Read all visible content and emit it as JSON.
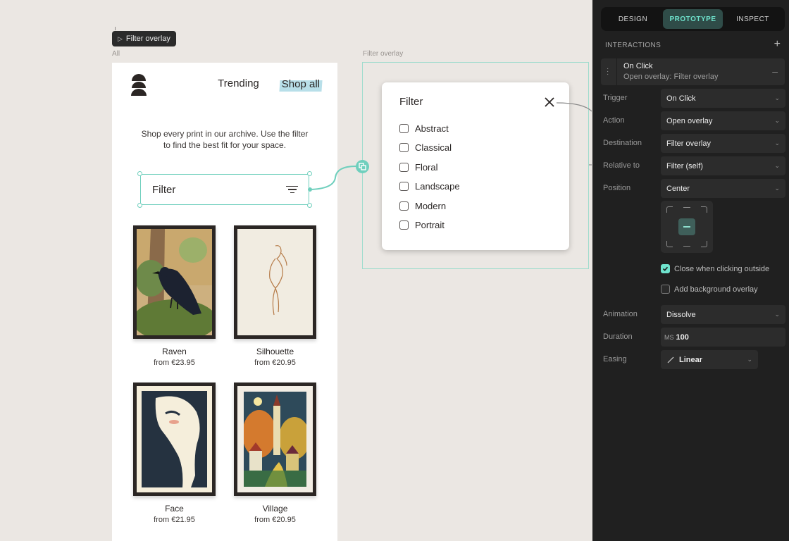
{
  "canvas": {
    "flow_tag": "Filter overlay",
    "frame_all_label": "All",
    "frame_overlay_label": "Filter overlay"
  },
  "page": {
    "nav": {
      "trending": "Trending",
      "shop_all": "Shop all"
    },
    "intro": "Shop every print in our archive. Use the filter to find the best fit for your space.",
    "filter_label": "Filter",
    "products": [
      {
        "title": "Raven",
        "price": "from €23.95",
        "art": "raven"
      },
      {
        "title": "Silhouette",
        "price": "from €20.95",
        "art": "silhouette"
      },
      {
        "title": "Face",
        "price": "from €21.95",
        "art": "face"
      },
      {
        "title": "Village",
        "price": "from €20.95",
        "art": "village"
      }
    ]
  },
  "overlay": {
    "title": "Filter",
    "options": [
      "Abstract",
      "Classical",
      "Floral",
      "Landscape",
      "Modern",
      "Portrait"
    ]
  },
  "panel": {
    "tabs": [
      "DESIGN",
      "PROTOTYPE",
      "INSPECT"
    ],
    "active_tab": "PROTOTYPE",
    "section_title": "INTERACTIONS",
    "interaction": {
      "trigger": "On Click",
      "summary": "Open overlay: Filter overlay"
    },
    "fields": {
      "trigger": {
        "label": "Trigger",
        "value": "On Click"
      },
      "action": {
        "label": "Action",
        "value": "Open overlay"
      },
      "destination": {
        "label": "Destination",
        "value": "Filter overlay"
      },
      "relative_to": {
        "label": "Relative to",
        "value": "Filter (self)"
      },
      "position": {
        "label": "Position",
        "value": "Center"
      },
      "animation": {
        "label": "Animation",
        "value": "Dissolve"
      },
      "duration": {
        "label": "Duration",
        "unit": "MS",
        "value": "100"
      },
      "easing": {
        "label": "Easing",
        "value": "Linear"
      }
    },
    "close_outside": {
      "label": "Close when clicking outside",
      "checked": true
    },
    "background_overlay": {
      "label": "Add background overlay",
      "checked": false
    }
  },
  "colors": {
    "accent": "#6fcfbd",
    "accent_highlight": "#b8dfe9",
    "panel_bg": "#202020",
    "canvas_bg": "#ebe7e3"
  }
}
